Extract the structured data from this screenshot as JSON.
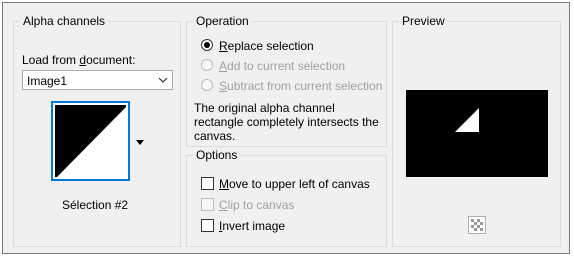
{
  "alpha_channels": {
    "title": "Alpha channels",
    "load_label_pre": "Load from ",
    "load_label_ul": "d",
    "load_label_post": "ocument:",
    "document_value": "Image1",
    "thumbnail_caption": "Sélection #2"
  },
  "operation": {
    "title": "Operation",
    "options": [
      {
        "ul": "R",
        "rest": "eplace selection",
        "checked": true,
        "enabled": true
      },
      {
        "ul": "A",
        "rest": "dd to current selection",
        "checked": false,
        "enabled": false
      },
      {
        "ul": "S",
        "rest": "ubtract from current selection",
        "checked": false,
        "enabled": false
      }
    ],
    "note_lines": [
      "The original alpha channel",
      "rectangle completely intersects the",
      "canvas."
    ]
  },
  "options": {
    "title": "Options",
    "items": [
      {
        "ul": "M",
        "rest": "ove to upper left of canvas",
        "checked": false,
        "enabled": true
      },
      {
        "ul": "C",
        "rest": "lip to canvas",
        "checked": false,
        "enabled": false
      },
      {
        "ul": "I",
        "rest": "nvert image",
        "checked": false,
        "enabled": true
      }
    ]
  },
  "preview": {
    "title": "Preview"
  },
  "colors": {
    "accent": "#0078d7",
    "dialog_bg": "#f0f0f0",
    "disabled_text": "#a0a0a0"
  }
}
